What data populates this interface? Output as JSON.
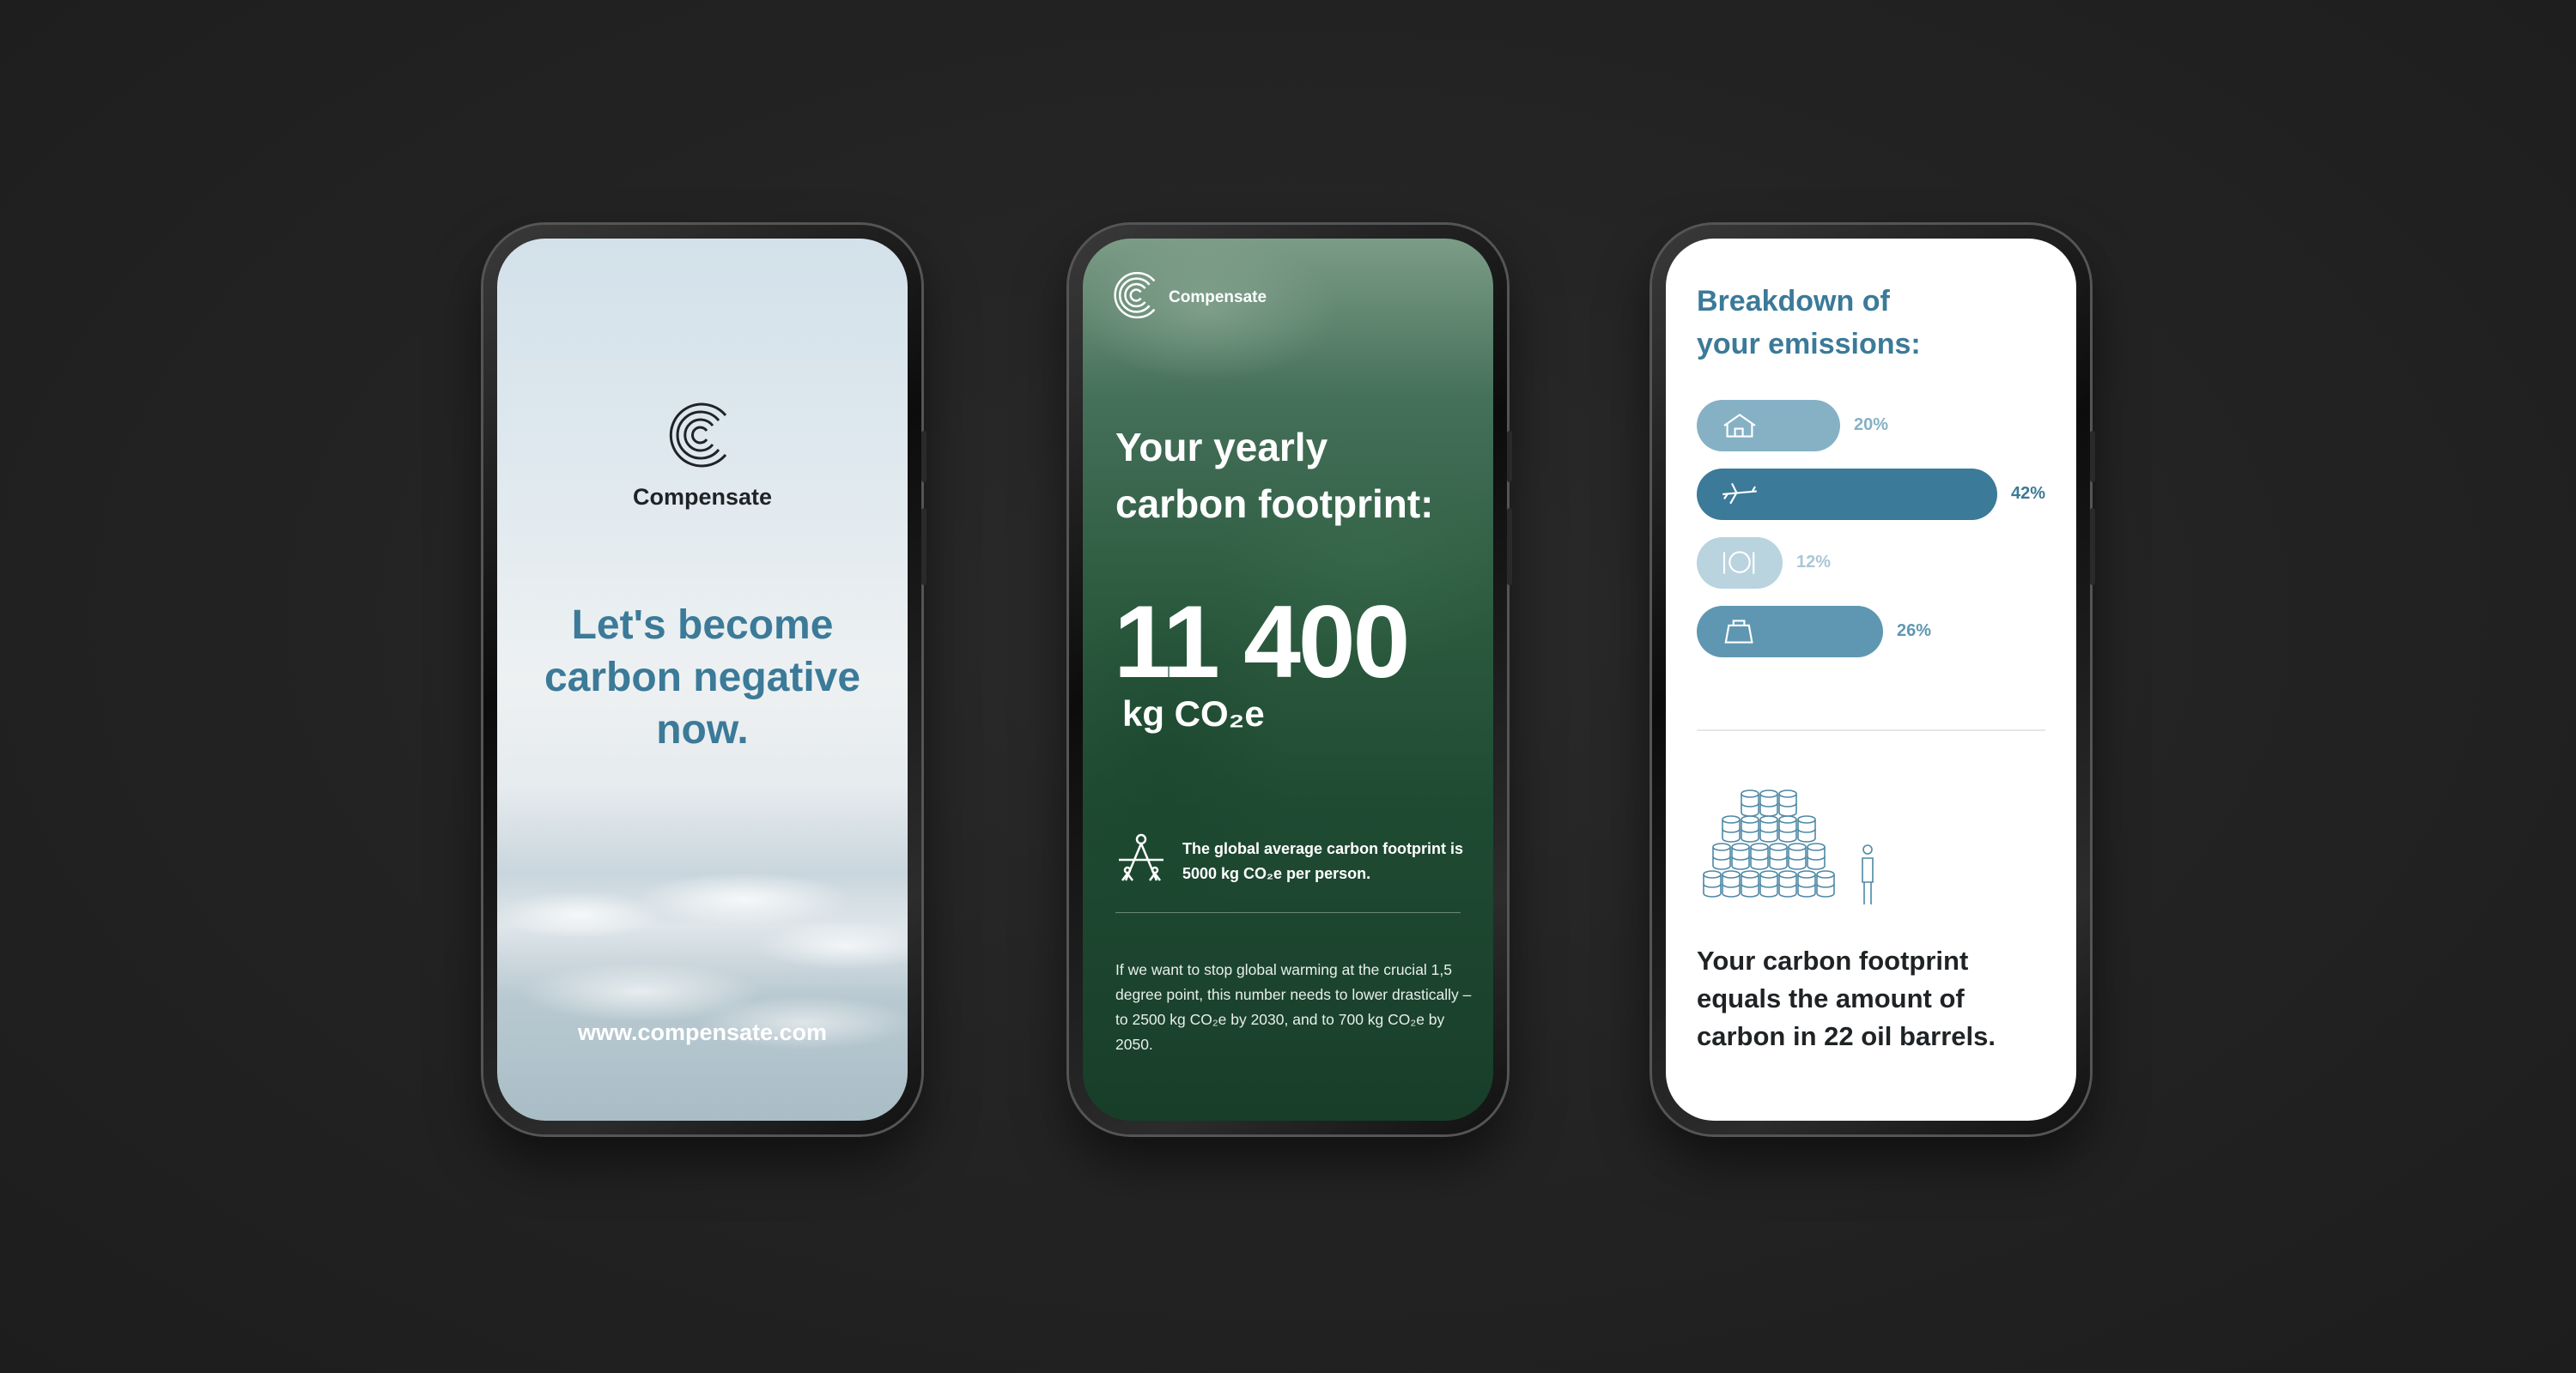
{
  "phone1": {
    "brand": "Compensate",
    "headline": "Let's become carbon negative now.",
    "url": "www.compensate.com"
  },
  "phone2": {
    "brand": "Compensate",
    "title_line1": "Your yearly",
    "title_line2": "carbon footprint:",
    "amount": "11 400",
    "unit": "kg CO₂e",
    "average_note": "The global average carbon footprint is 5000 kg CO₂e per person.",
    "body": "If we want to stop global warming at the crucial 1,5 degree point, this number needs to lower drastically – to 2500 kg CO₂e by 2030, and to 700 kg CO₂e by 2050."
  },
  "phone3": {
    "title_line1": "Breakdown of",
    "title_line2": "your emissions:",
    "breakdown": [
      {
        "category_icon": "house-icon",
        "percent_label": "20%",
        "value": 20,
        "color": "#86b1c5",
        "text_color": "#86b1c5"
      },
      {
        "category_icon": "airplane-icon",
        "percent_label": "42%",
        "value": 42,
        "color": "#3b7a98",
        "text_color": "#3b7a98"
      },
      {
        "category_icon": "plate-icon",
        "percent_label": "12%",
        "value": 12,
        "color": "#b9d3df",
        "text_color": "#a9c7d6"
      },
      {
        "category_icon": "shopping-bag-icon",
        "percent_label": "26%",
        "value": 26,
        "color": "#5f97b2",
        "text_color": "#5f97b2"
      }
    ],
    "summary": "Your carbon footprint equals the amount of carbon in 22 oil barrels."
  },
  "colors": {
    "accent": "#3b7a98",
    "dark_text": "#1f2325",
    "background": "#222222"
  }
}
